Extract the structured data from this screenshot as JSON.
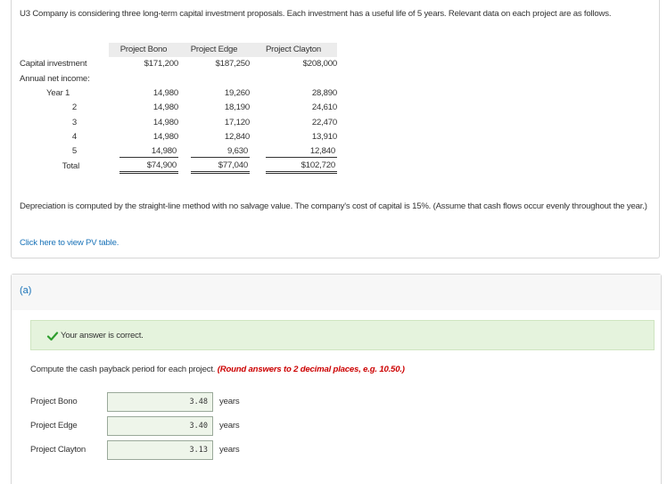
{
  "intro": "U3 Company is considering three long-term capital investment proposals. Each investment has a useful life of 5 years. Relevant data on each project are as follows.",
  "table": {
    "headers": [
      "Project Bono",
      "Project Edge",
      "Project Clayton"
    ],
    "capital_label": "Capital investment",
    "capital_values": [
      "$171,200",
      "$187,250",
      "$208,000"
    ],
    "income_label": "Annual net income:",
    "year1_label": "Year 1",
    "rows": [
      {
        "label": "",
        "values": [
          "14,980",
          "19,260",
          "28,890"
        ]
      },
      {
        "label": "2",
        "values": [
          "14,980",
          "18,190",
          "24,610"
        ]
      },
      {
        "label": "3",
        "values": [
          "14,980",
          "17,120",
          "22,470"
        ]
      },
      {
        "label": "4",
        "values": [
          "14,980",
          "12,840",
          "13,910"
        ]
      },
      {
        "label": "5",
        "values": [
          "14,980",
          "9,630",
          "12,840"
        ]
      }
    ],
    "total_label": "Total",
    "total_values": [
      "$74,900",
      "$77,040",
      "$102,720"
    ]
  },
  "depreciation": "Depreciation is computed by the straight-line method with no salvage value. The company's cost of capital is 15%. (Assume that cash flows occur evenly throughout the year.)",
  "pv_link": "Click here to view PV table.",
  "part": {
    "label": "(a)",
    "correct_message": "Your answer is correct.",
    "instruction_text": "Compute the cash payback period for each project.",
    "instruction_note": "(Round answers to 2 decimal places, e.g. 10.50.)",
    "answers": [
      {
        "label": "Project Bono",
        "value": "3.48",
        "unit": "years"
      },
      {
        "label": "Project Edge",
        "value": "3.40",
        "unit": "years"
      },
      {
        "label": "Project Clayton",
        "value": "3.13",
        "unit": "years"
      }
    ]
  },
  "colors": {
    "link": "#1a73b8",
    "success_bg": "#e5f3dd",
    "check": "#2e9e2e",
    "note": "#cc0000"
  }
}
